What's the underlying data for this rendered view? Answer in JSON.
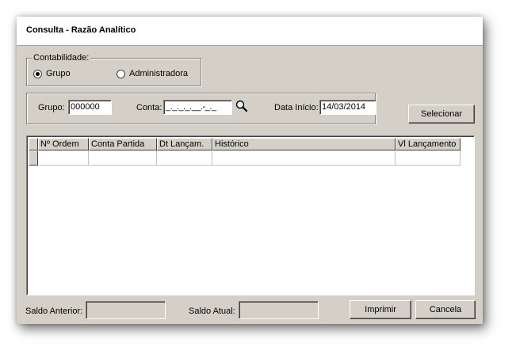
{
  "window": {
    "title": "Consulta - Razão Analítico"
  },
  "contabilidade": {
    "legend": "Contabilidade:",
    "options": [
      {
        "label": "Grupo",
        "selected": true
      },
      {
        "label": "Administradora",
        "selected": false
      }
    ]
  },
  "filters": {
    "grupo_label": "Grupo:",
    "grupo_value": "000000",
    "conta_label": "Conta:",
    "conta_value": "_._._._.__.-_._",
    "conta_search_icon": "magnifier-icon",
    "data_inicio_label": "Data Início:",
    "data_inicio_value": "14/03/2014"
  },
  "buttons": {
    "selecionar": "Selecionar",
    "imprimir": "Imprimir",
    "cancela": "Cancela"
  },
  "grid": {
    "columns": [
      "Nº Ordem",
      "Conta Partida",
      "Dt Lançam.",
      "Histórico",
      "Vl Lançamento"
    ],
    "rows": [
      [
        "",
        "",
        "",
        "",
        ""
      ]
    ]
  },
  "footer": {
    "saldo_anterior_label": "Saldo Anterior:",
    "saldo_anterior_value": "",
    "saldo_atual_label": "Saldo Atual:",
    "saldo_atual_value": ""
  }
}
